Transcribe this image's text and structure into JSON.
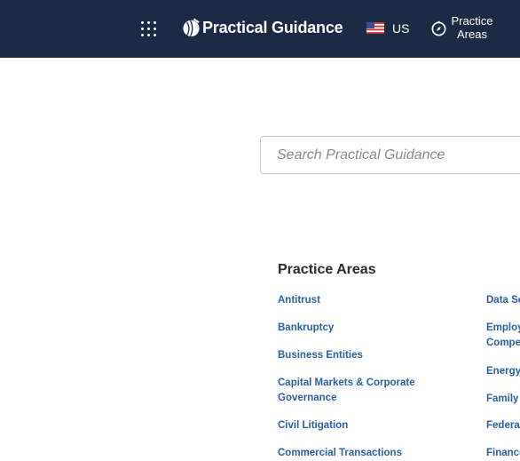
{
  "header": {
    "brand": "Practical Guidance",
    "region": "US",
    "nav_practice_areas": "Practice Areas",
    "icons": {
      "apps": "apps-grid-icon",
      "logo": "brand-logo-icon",
      "flag": "us-flag-icon",
      "compass": "compass-icon"
    }
  },
  "search": {
    "placeholder": "Search Practical Guidance",
    "value": ""
  },
  "practice_areas": {
    "title": "Practice Areas",
    "column_1": [
      "Antitrust",
      "Bankruptcy",
      "Business Entities",
      "Capital Markets & Corporate Governance",
      "Civil Litigation",
      "Commercial Transactions"
    ],
    "column_2": [
      "Data Se",
      "Employ Compe",
      "Energy",
      "Family",
      "Federal",
      "Finance"
    ]
  },
  "colors": {
    "header_bg": "#1c2b45",
    "link": "#2c5ea8",
    "text": "#2b2b2b"
  }
}
